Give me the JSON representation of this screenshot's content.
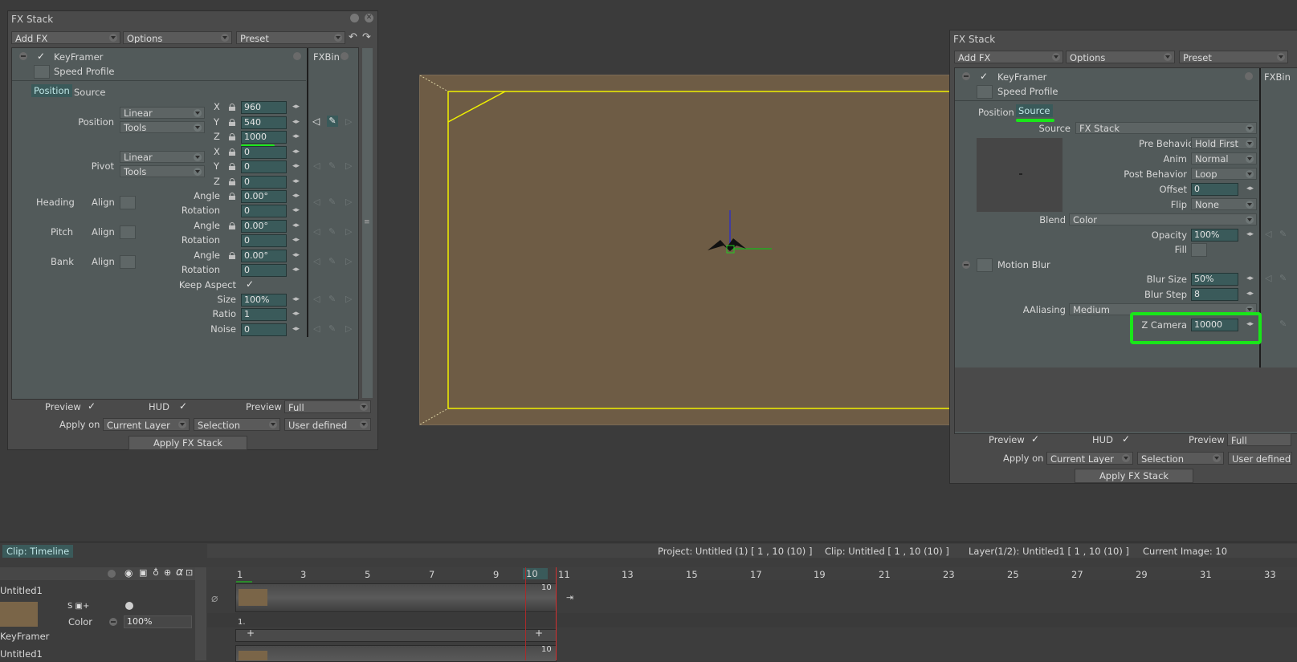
{
  "left_panel": {
    "title": "FX Stack",
    "add_fx": "Add FX",
    "options": "Options",
    "preset": "Preset",
    "effect_name": "KeyFramer",
    "speed_profile": "Speed Profile",
    "fxbin": "FXBin",
    "tabs": [
      "Position",
      "Source"
    ],
    "position": {
      "label": "Position",
      "interp": "Linear",
      "tools": "Tools",
      "x_label": "X",
      "x": "960",
      "y_label": "Y",
      "y": "540",
      "z_label": "Z",
      "z": "1000"
    },
    "pivot": {
      "label": "Pivot",
      "interp": "Linear",
      "tools": "Tools",
      "x_label": "X",
      "x": "0",
      "y_label": "Y",
      "y": "0",
      "z_label": "Z",
      "z": "0"
    },
    "heading": {
      "label": "Heading",
      "align": "Align",
      "angle_label": "Angle",
      "angle": "0.00°",
      "rotation_label": "Rotation",
      "rotation": "0"
    },
    "pitch": {
      "label": "Pitch",
      "align": "Align",
      "angle_label": "Angle",
      "angle": "0.00°",
      "rotation_label": "Rotation",
      "rotation": "0"
    },
    "bank": {
      "label": "Bank",
      "align": "Align",
      "angle_label": "Angle",
      "angle": "0.00°",
      "rotation_label": "Rotation",
      "rotation": "0"
    },
    "keep_aspect": "Keep Aspect",
    "size_label": "Size",
    "size": "100%",
    "ratio_label": "Ratio",
    "ratio": "1",
    "noise_label": "Noise",
    "noise": "0",
    "preview": "Preview",
    "hud": "HUD",
    "preview2": "Preview",
    "preview_mode": "Full",
    "apply_on": "Apply on",
    "apply_layer": "Current Layer",
    "apply_sel": "Selection",
    "apply_user": "User defined",
    "apply_btn": "Apply FX Stack"
  },
  "right_panel": {
    "title": "FX Stack",
    "add_fx": "Add FX",
    "options": "Options",
    "preset": "Preset",
    "effect_name": "KeyFramer",
    "speed_profile": "Speed Profile",
    "fxbin": "FXBin",
    "tabs": [
      "Position",
      "Source"
    ],
    "source_label": "Source",
    "source": "FX Stack",
    "pre_behavior_label": "Pre Behavior",
    "pre_behavior": "Hold First",
    "anim_label": "Anim",
    "anim": "Normal",
    "post_behavior_label": "Post Behavior",
    "post_behavior": "Loop",
    "offset_label": "Offset",
    "offset": "0",
    "flip_label": "Flip",
    "flip": "None",
    "blend_label": "Blend",
    "blend": "Color",
    "opacity_label": "Opacity",
    "opacity": "100%",
    "fill_label": "Fill",
    "motion_blur": "Motion Blur",
    "blur_size_label": "Blur Size",
    "blur_size": "50%",
    "blur_step_label": "Blur Step",
    "blur_step": "8",
    "aaliasing_label": "AAliasing",
    "aaliasing": "Medium",
    "zcamera_label": "Z Camera",
    "zcamera": "10000",
    "preview": "Preview",
    "hud": "HUD",
    "preview2": "Preview",
    "preview_mode": "Full",
    "apply_on": "Apply on",
    "apply_layer": "Current Layer",
    "apply_sel": "Selection",
    "apply_user": "User defined",
    "apply_btn": "Apply FX Stack"
  },
  "timeline": {
    "tab": "Clip: Timeline",
    "project": "Project: Untitled (1) [ 1 , 10  (10) ]",
    "clip": "Clip: Untitled [ 1 , 10  (10) ]",
    "layer": "Layer(1/2): Untitled1 [ 1 , 10  (10) ]",
    "current": "Current Image: 10",
    "ticks": [
      "1",
      "3",
      "5",
      "7",
      "9",
      "10",
      "11",
      "13",
      "15",
      "17",
      "19",
      "21",
      "23",
      "25",
      "27",
      "29",
      "31",
      "33"
    ],
    "layer1": "Untitled1",
    "color_label": "Color",
    "opacity": "100%",
    "fx": "KeyFramer",
    "layer2": "Untitled1",
    "track_end": "10",
    "track_start": "1.",
    "track_end2": "10"
  },
  "colors": {
    "accent": "#19e619",
    "canvas": "#6e5c45",
    "frame": "#f0f000"
  }
}
